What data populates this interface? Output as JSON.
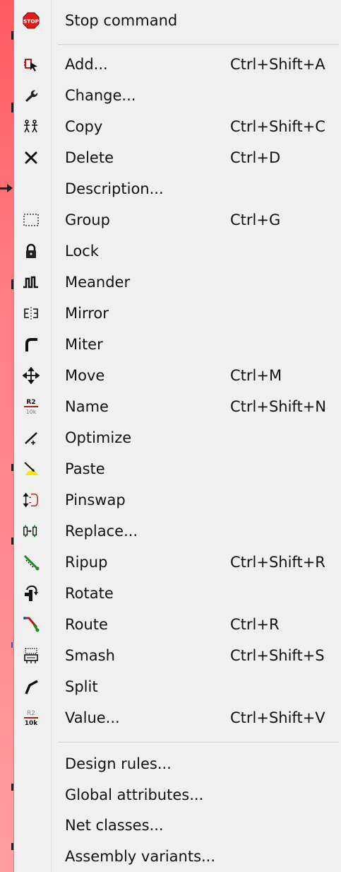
{
  "menu": {
    "top": [
      {
        "label": "Stop command",
        "shortcut": "",
        "icon": "stop-icon"
      }
    ],
    "commands": [
      {
        "label": "Add...",
        "shortcut": "Ctrl+Shift+A",
        "icon": "add-icon"
      },
      {
        "label": "Change...",
        "shortcut": "",
        "icon": "wrench-icon"
      },
      {
        "label": "Copy",
        "shortcut": "Ctrl+Shift+C",
        "icon": "copy-icon"
      },
      {
        "label": "Delete",
        "shortcut": "Ctrl+D",
        "icon": "delete-icon"
      },
      {
        "label": "Description...",
        "shortcut": "",
        "icon": ""
      },
      {
        "label": "Group",
        "shortcut": "Ctrl+G",
        "icon": "group-icon"
      },
      {
        "label": "Lock",
        "shortcut": "",
        "icon": "lock-icon"
      },
      {
        "label": "Meander",
        "shortcut": "",
        "icon": "meander-icon"
      },
      {
        "label": "Mirror",
        "shortcut": "",
        "icon": "mirror-icon"
      },
      {
        "label": "Miter",
        "shortcut": "",
        "icon": "miter-icon"
      },
      {
        "label": "Move",
        "shortcut": "Ctrl+M",
        "icon": "move-icon"
      },
      {
        "label": "Name",
        "shortcut": "Ctrl+Shift+N",
        "icon": "name-icon"
      },
      {
        "label": "Optimize",
        "shortcut": "",
        "icon": "optimize-icon"
      },
      {
        "label": "Paste",
        "shortcut": "",
        "icon": "paste-icon"
      },
      {
        "label": "Pinswap",
        "shortcut": "",
        "icon": "pinswap-icon"
      },
      {
        "label": "Replace...",
        "shortcut": "",
        "icon": "replace-icon"
      },
      {
        "label": "Ripup",
        "shortcut": "Ctrl+Shift+R",
        "icon": "ripup-icon"
      },
      {
        "label": "Rotate",
        "shortcut": "",
        "icon": "rotate-icon"
      },
      {
        "label": "Route",
        "shortcut": "Ctrl+R",
        "icon": "route-icon"
      },
      {
        "label": "Smash",
        "shortcut": "Ctrl+Shift+S",
        "icon": "smash-icon"
      },
      {
        "label": "Split",
        "shortcut": "",
        "icon": "split-icon"
      },
      {
        "label": "Value...",
        "shortcut": "Ctrl+Shift+V",
        "icon": "value-icon"
      }
    ],
    "settings": [
      {
        "label": "Design rules..."
      },
      {
        "label": "Global attributes..."
      },
      {
        "label": "Net classes..."
      },
      {
        "label": "Assembly variants..."
      }
    ],
    "icon_text": {
      "stop": "STOP",
      "name_top": "R2",
      "name_bottom": "10k",
      "value_top": "R2",
      "value_bottom": "10k"
    }
  },
  "colors": {
    "menu_bg": "#f0f0f0",
    "left_strip": "#ff6f75",
    "stop_red": "#e01b1b"
  }
}
